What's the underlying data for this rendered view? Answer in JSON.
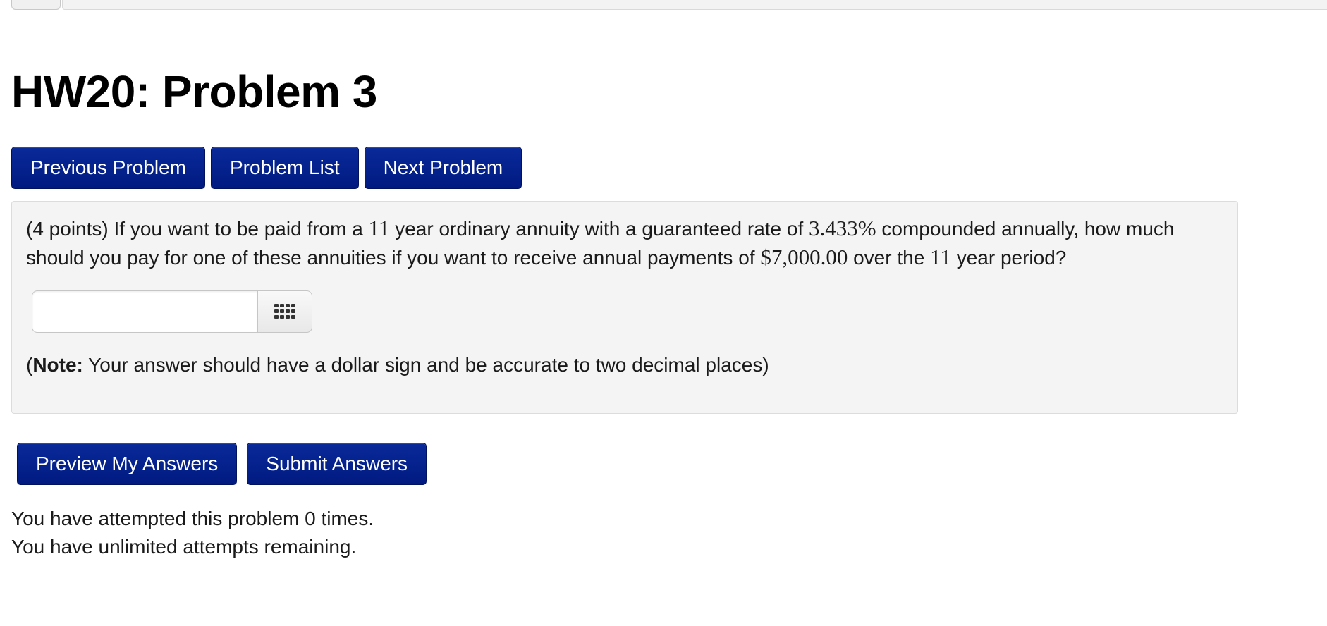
{
  "page_title": "HW20: Problem 3",
  "nav": {
    "previous": "Previous Problem",
    "list": "Problem List",
    "next": "Next Problem"
  },
  "problem": {
    "points": "(4 points)",
    "segments": {
      "t1": " If you want to be paid from a ",
      "m1": "11",
      "t2": " year ordinary annuity with a guaranteed rate of ",
      "m2": "3.433%",
      "t3": " compounded annually, how much should you pay for one of these annuities if you want to receive annual payments of ",
      "m3": "$7,000.00",
      "t4": " over the ",
      "m4": "11",
      "t5": " year period?"
    },
    "answer_value": "",
    "keypad_icon": "keypad-grid-icon",
    "note_open": "(",
    "note_label": "Note:",
    "note_text": " Your answer should have a dollar sign and be accurate to two decimal places)"
  },
  "actions": {
    "preview": "Preview My Answers",
    "submit": "Submit Answers"
  },
  "status": {
    "attempts": "You have attempted this problem 0 times.",
    "remaining": "You have unlimited attempts remaining."
  },
  "colors": {
    "button_bg": "#001a80",
    "button_text": "#ffffff",
    "panel_bg": "#f4f4f4"
  }
}
